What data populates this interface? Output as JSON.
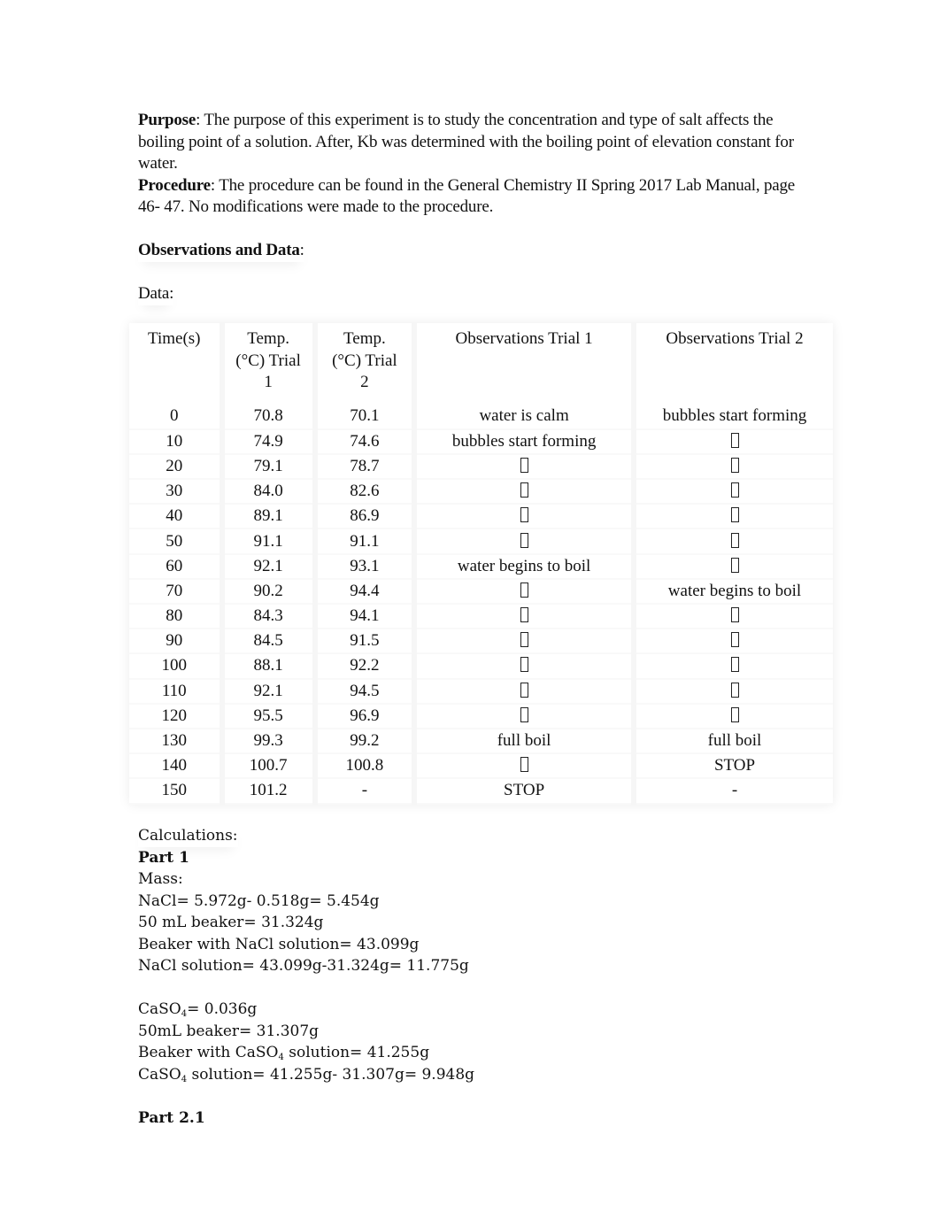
{
  "purpose": {
    "label": "Purpose",
    "text": ": The purpose of this experiment is to study the concentration and type of salt affects the boiling point of a solution. After, Kb was determined with the boiling point of elevation constant for water."
  },
  "procedure": {
    "label": "Procedure",
    "text": ": The procedure can be found in the General Chemistry II Spring 2017 Lab Manual, page 46- 47. No modifications were made to the procedure."
  },
  "observations": {
    "heading": "Observations and Data",
    "heading_suffix": ":",
    "data_label": "Data:"
  },
  "table": {
    "headers": [
      "Time(s)",
      "Temp. (°C) Trial 1",
      "Temp. (°C)  Trial 2",
      "Observations Trial 1",
      "Observations Trial 2"
    ],
    "placeholder_glyph": "missing-glyph-box",
    "rows": [
      {
        "time": "0",
        "t1": "70.8",
        "t2": "70.1",
        "obs1": "water is calm",
        "obs2": "bubbles start forming"
      },
      {
        "time": "10",
        "t1": "74.9",
        "t2": "74.6",
        "obs1": "bubbles start forming",
        "obs2": "[box]"
      },
      {
        "time": "20",
        "t1": "79.1",
        "t2": "78.7",
        "obs1": "[box]",
        "obs2": "[box]"
      },
      {
        "time": "30",
        "t1": "84.0",
        "t2": "82.6",
        "obs1": "[box]",
        "obs2": "[box]"
      },
      {
        "time": "40",
        "t1": "89.1",
        "t2": "86.9",
        "obs1": "[box]",
        "obs2": "[box]"
      },
      {
        "time": "50",
        "t1": "91.1",
        "t2": "91.1",
        "obs1": "[box]",
        "obs2": "[box]"
      },
      {
        "time": "60",
        "t1": "92.1",
        "t2": "93.1",
        "obs1": "water begins to boil",
        "obs2": "[box]"
      },
      {
        "time": "70",
        "t1": "90.2",
        "t2": "94.4",
        "obs1": "[box]",
        "obs2": "water begins to boil"
      },
      {
        "time": "80",
        "t1": "84.3",
        "t2": "94.1",
        "obs1": "[box]",
        "obs2": "[box]"
      },
      {
        "time": "90",
        "t1": "84.5",
        "t2": "91.5",
        "obs1": "[box]",
        "obs2": "[box]"
      },
      {
        "time": "100",
        "t1": "88.1",
        "t2": "92.2",
        "obs1": "[box]",
        "obs2": "[box]"
      },
      {
        "time": "110",
        "t1": "92.1",
        "t2": "94.5",
        "obs1": "[box]",
        "obs2": "[box]"
      },
      {
        "time": "120",
        "t1": "95.5",
        "t2": "96.9",
        "obs1": "[box]",
        "obs2": "[box]"
      },
      {
        "time": "130",
        "t1": "99.3",
        "t2": "99.2",
        "obs1": "full boil",
        "obs2": "full boil"
      },
      {
        "time": "140",
        "t1": "100.7",
        "t2": "100.8",
        "obs1": "[box]",
        "obs2": "STOP"
      },
      {
        "time": "150",
        "t1": "101.2",
        "t2": "-",
        "obs1": "STOP",
        "obs2": "-"
      }
    ]
  },
  "calculations": {
    "label": "Calculations:",
    "part1": {
      "heading": "Part 1",
      "mass_label": "Mass:",
      "nacl_lines": [
        "NaCl= 5.972g- 0.518g= 5.454g",
        "50 mL beaker= 31.324g",
        "Beaker with NaCl solution= 43.099g",
        "NaCl solution= 43.099g-31.324g= 11.775g"
      ],
      "caso4_lines": [
        {
          "pre": "CaSO",
          "sub": "4",
          "post": "= 0.036g"
        },
        {
          "pre": "50mL beaker= 31.307g",
          "sub": "",
          "post": ""
        },
        {
          "pre": "Beaker with CaSO",
          "sub": "4",
          "post": " solution= 41.255g"
        },
        {
          "pre": "CaSO",
          "sub": "4",
          "post": " solution= 41.255g- 31.307g= 9.948g"
        }
      ]
    },
    "part2_heading": "Part 2.1"
  }
}
